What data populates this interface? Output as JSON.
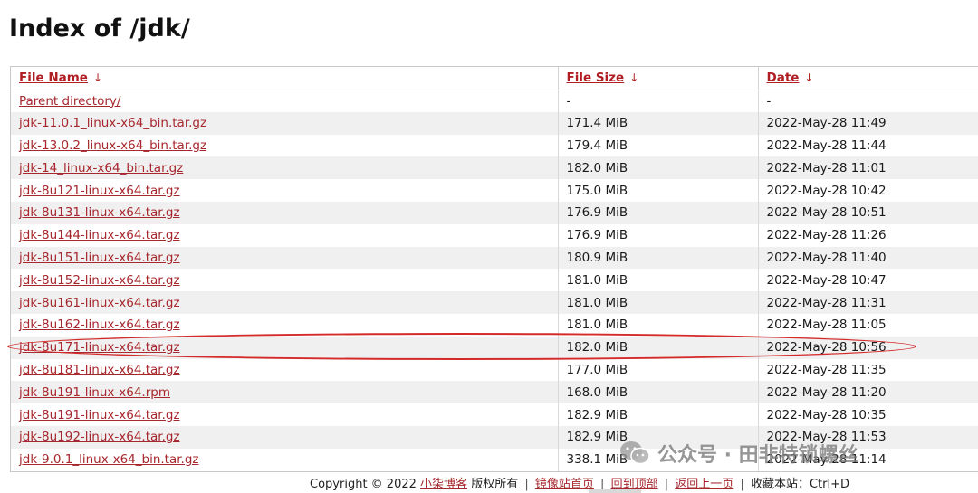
{
  "page": {
    "title": "Index of /jdk/"
  },
  "table": {
    "headers": [
      {
        "label": "File Name",
        "arrow": "↓"
      },
      {
        "label": "File Size",
        "arrow": "↓"
      },
      {
        "label": "Date",
        "arrow": "↓"
      }
    ],
    "rows": [
      {
        "name": "Parent directory/",
        "size": "-",
        "date": "-"
      },
      {
        "name": "jdk-11.0.1_linux-x64_bin.tar.gz",
        "size": "171.4 MiB",
        "date": "2022-May-28 11:49"
      },
      {
        "name": "jdk-13.0.2_linux-x64_bin.tar.gz",
        "size": "179.4 MiB",
        "date": "2022-May-28 11:44"
      },
      {
        "name": "jdk-14_linux-x64_bin.tar.gz",
        "size": "182.0 MiB",
        "date": "2022-May-28 11:01"
      },
      {
        "name": "jdk-8u121-linux-x64.tar.gz",
        "size": "175.0 MiB",
        "date": "2022-May-28 10:42"
      },
      {
        "name": "jdk-8u131-linux-x64.tar.gz",
        "size": "176.9 MiB",
        "date": "2022-May-28 10:51"
      },
      {
        "name": "jdk-8u144-linux-x64.tar.gz",
        "size": "176.9 MiB",
        "date": "2022-May-28 11:26"
      },
      {
        "name": "jdk-8u151-linux-x64.tar.gz",
        "size": "180.9 MiB",
        "date": "2022-May-28 11:40"
      },
      {
        "name": "jdk-8u152-linux-x64.tar.gz",
        "size": "181.0 MiB",
        "date": "2022-May-28 10:47"
      },
      {
        "name": "jdk-8u161-linux-x64.tar.gz",
        "size": "181.0 MiB",
        "date": "2022-May-28 11:31"
      },
      {
        "name": "jdk-8u162-linux-x64.tar.gz",
        "size": "181.0 MiB",
        "date": "2022-May-28 11:05"
      },
      {
        "name": "jdk-8u171-linux-x64.tar.gz",
        "size": "182.0 MiB",
        "date": "2022-May-28 10:56"
      },
      {
        "name": "jdk-8u181-linux-x64.tar.gz",
        "size": "177.0 MiB",
        "date": "2022-May-28 11:35"
      },
      {
        "name": "jdk-8u191-linux-x64.rpm",
        "size": "168.0 MiB",
        "date": "2022-May-28 11:20"
      },
      {
        "name": "jdk-8u191-linux-x64.tar.gz",
        "size": "182.9 MiB",
        "date": "2022-May-28 10:35"
      },
      {
        "name": "jdk-8u192-linux-x64.tar.gz",
        "size": "182.9 MiB",
        "date": "2022-May-28 11:53"
      },
      {
        "name": "jdk-9.0.1_linux-x64_bin.tar.gz",
        "size": "338.1 MiB",
        "date": "2022-May-28 11:14"
      }
    ]
  },
  "footer": {
    "copyright": "Copyright © 2022",
    "site_link": "小柒博客",
    "rights": "版权所有",
    "sep": "|",
    "mirror_link": "镜像站首页",
    "top_link": "回到顶部",
    "back_link": "返回上一页",
    "bookmark": "收藏本站：Ctrl+D"
  },
  "watermark": {
    "text": "公众号 · 田非特锁螺丝",
    "icon": "wechat-icon"
  },
  "colors": {
    "link": "#a6272d",
    "header_link": "#b01e24",
    "alt_row": "#f0f0f0",
    "highlight": "#d42a2a"
  }
}
